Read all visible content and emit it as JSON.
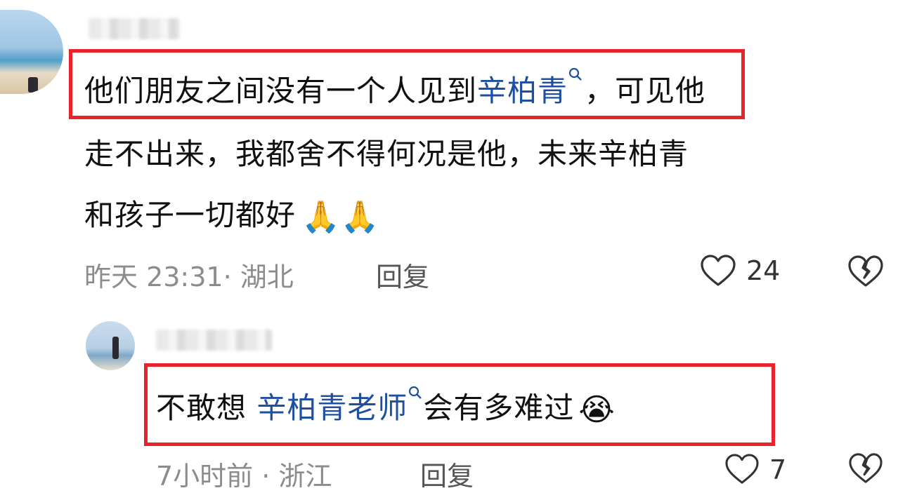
{
  "comment1": {
    "line1_text": "他们朋友之间没有一个人见到",
    "line1_link": "辛柏青",
    "line1_rest": "，可见他",
    "line2": "走不出来，我都舍不得何况是他，未来辛柏青",
    "line3": "和孩子一切都好",
    "line3_emoji": "🙏🙏",
    "meta": "昨天 23:31· 湖北",
    "reply": "回复",
    "likes": "24"
  },
  "comment2": {
    "text_prefix": "不敢想 ",
    "link": "辛柏青老师",
    "text_suffix": "会有多难过",
    "emoji": "😭",
    "meta": "7小时前 · 浙江",
    "reply": "回复",
    "likes": "7"
  },
  "colors": {
    "link": "#1f4fa0",
    "highlight_box": "#e8232b",
    "meta": "#8c8c8c"
  },
  "icons": {
    "search": "search-icon",
    "like": "heart-icon",
    "dislike": "broken-heart-icon"
  }
}
